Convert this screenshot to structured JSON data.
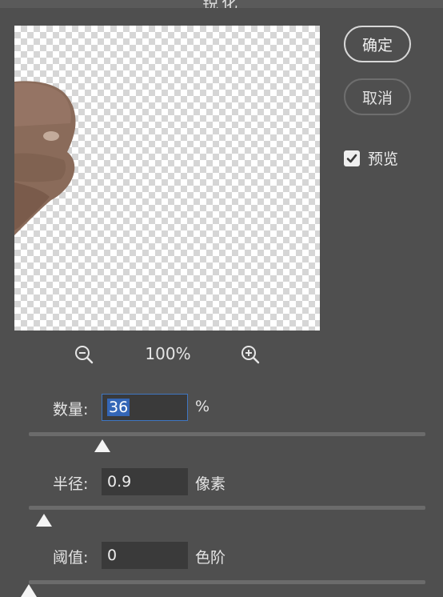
{
  "dialog": {
    "title": "锐化"
  },
  "buttons": {
    "ok_label": "确定",
    "cancel_label": "取消"
  },
  "preview_toggle": {
    "label": "预览",
    "checked": true
  },
  "zoom": {
    "level": "100%",
    "zoom_out_icon": "zoom-out-icon",
    "zoom_in_icon": "zoom-in-icon"
  },
  "params": {
    "amount": {
      "label": "数量:",
      "value": "36",
      "unit": "%",
      "slider_fraction": 0.185
    },
    "radius": {
      "label": "半径:",
      "value": "0.9",
      "unit": "像素",
      "slider_fraction": 0.038
    },
    "threshold": {
      "label": "阈值:",
      "value": "0",
      "unit": "色阶",
      "slider_fraction": 0.0
    }
  },
  "colors": {
    "background": "#4f4f4f",
    "focus_border": "#3f76c2",
    "selection": "#3466b6"
  }
}
